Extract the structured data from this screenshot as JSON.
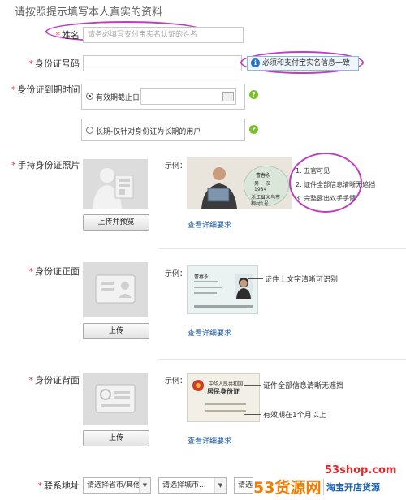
{
  "page": {
    "title": "请按照提示填写本人真实的资料"
  },
  "fields": {
    "name": {
      "label": "姓名",
      "placeholder": "请务必填写支付宝实名认证的姓名"
    },
    "id_number": {
      "label": "身份证号码",
      "hint": "必须和支付宝实名信息一致"
    },
    "id_expiry": {
      "label": "身份证到期时间",
      "option_expiry": "有效期截止日",
      "option_longterm": "长期-仅针对身份证为长期的用户"
    },
    "handheld_photo": {
      "label": "手持身份证照片",
      "button": "上传并预览",
      "example_label": "示例：",
      "link": "查看详细要求",
      "card_text": [
        "曹春永",
        "男",
        "汉",
        "1984",
        "浙江省义乌市",
        "稠村1号"
      ],
      "requirements": [
        "1. 五官可见",
        "2. 证件全部信息清晰无遮挡",
        "3. 完整露出双手手臂"
      ]
    },
    "id_front": {
      "label": "身份证正面",
      "button": "上传",
      "example_label": "示例：",
      "link": "查看详细要求",
      "callout": "证件上文字清晰可识别",
      "card_name": "曹春永"
    },
    "id_back": {
      "label": "身份证背面",
      "button": "上传",
      "example_label": "示例：",
      "link": "查看详细要求",
      "callout_1": "证件全部信息清晰无遮挡",
      "callout_2": "有效期在1个月以上",
      "card_title_1": "中华人民共和国",
      "card_title_2": "居民身份证"
    },
    "address": {
      "label": "联系地址",
      "select_province": "请选择省市/其他",
      "select_city": "请选择城市...",
      "select_district": "请选择"
    }
  },
  "watermark": {
    "site": "53shop.com",
    "brand": "53货源网",
    "slogan": "淘宝开店货源"
  },
  "colors": {
    "required_star": "#e4393c",
    "highlight_ellipse": "#c03cc0",
    "link": "#1f5ea8",
    "watermark_red": "#e3282c",
    "watermark_orange": "#f07d00"
  },
  "icons": {
    "info": "info-icon",
    "help": "question-icon",
    "calendar": "calendar-icon",
    "radio": "radio-icon",
    "dropdown": "chevron-down-icon"
  }
}
